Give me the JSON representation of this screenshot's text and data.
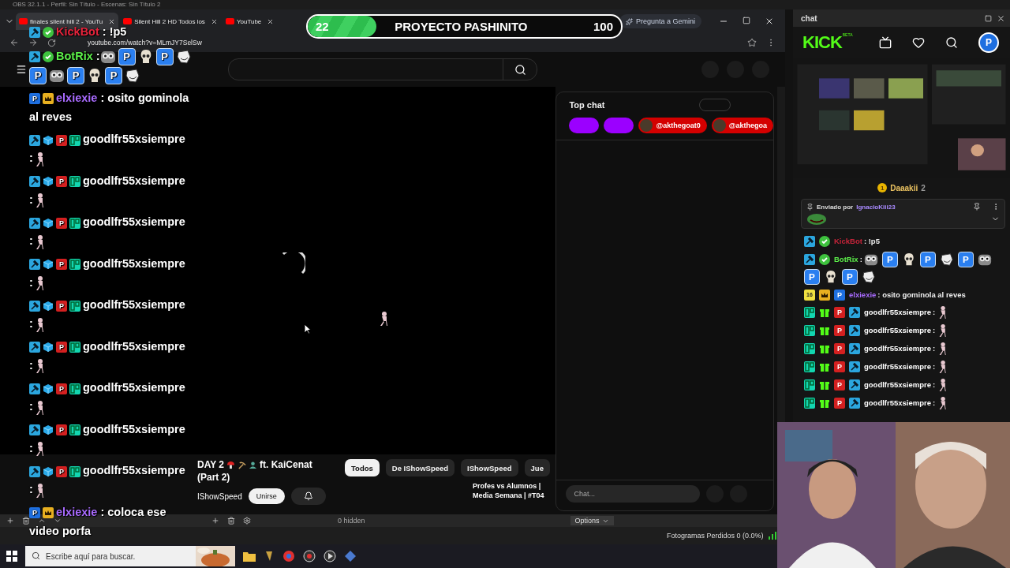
{
  "obs_title": "OBS 32.1.1 - Perfil: Sin Título - Escenas: Sin Título 2",
  "browser": {
    "tabs": [
      {
        "label": "finales silent hill 2 - YouTu",
        "selected": true
      },
      {
        "label": "Silent Hill 2 HD Todos los",
        "selected": false
      },
      {
        "label": "YouTube",
        "selected": false
      }
    ],
    "gemini": "Pregunta a Gemini",
    "url": "youtube.com/watch?v=MLmJY7SelSw"
  },
  "video": {
    "title_parts": [
      "DAY 2",
      "ft. KaiCenat"
    ],
    "title_line_2": "(Part 2)",
    "channel": "IShowSpeed",
    "join_button": "Unirse",
    "chips": [
      {
        "label": "Todos",
        "selected": true
      },
      {
        "label": "De IShowSpeed",
        "selected": false
      },
      {
        "label": "IShowSpeed",
        "selected": false
      },
      {
        "label": "Jue",
        "selected": false
      }
    ],
    "recommendation": "Profes vs Alumnos | Media Semana | #T04"
  },
  "top_chat": {
    "title": "Top chat",
    "chips": [
      {
        "kind": "blank"
      },
      {
        "kind": "blank"
      },
      {
        "kind": "user",
        "label": "@akthegoat0"
      },
      {
        "kind": "user",
        "label": "@akthegoa"
      }
    ],
    "input": {
      "placeholder": "Chat..."
    }
  },
  "goal": {
    "current": "22",
    "title": "PROYECTO PASHINITO",
    "target": "100",
    "level": 0.22
  },
  "overlay_chat": [
    {
      "kind": "inline",
      "name": "KickBot",
      "color": "#e8243c",
      "badges": [
        {
          "kind": "mod"
        },
        {
          "kind": "verified"
        }
      ],
      "text": " : !p5"
    },
    {
      "kind": "inline",
      "name": "BotRix",
      "color": "#5cf04a",
      "badges": [
        {
          "kind": "mod"
        },
        {
          "kind": "verified"
        }
      ],
      "text": " :",
      "emotes": [
        {
          "kind": "owl"
        },
        {
          "kind": "p",
          "label": "P"
        },
        {
          "kind": "skull"
        },
        {
          "kind": "p",
          "label": "P"
        },
        {
          "kind": "troll"
        },
        {
          "kind": "p",
          "label": "P"
        },
        {
          "kind": "owl"
        },
        {
          "kind": "p",
          "label": "P"
        },
        {
          "kind": "skull"
        },
        {
          "kind": "p",
          "label": "P"
        },
        {
          "kind": "troll"
        }
      ]
    },
    {
      "kind": "inline",
      "name": "elxiexie",
      "color": "#a96bff",
      "badges": [
        {
          "kind": "p",
          "label": "P"
        },
        {
          "kind": "crown"
        }
      ],
      "text": " : osito gominola",
      "text_line_2": "al reves"
    },
    {
      "kind": "block",
      "name": "goodlfr55xsiempre",
      "color": "#ffffff",
      "badges": [
        {
          "kind": "mod"
        },
        {
          "kind": "cube"
        },
        {
          "kind": "p-red",
          "label": "P"
        },
        {
          "kind": "gg"
        }
      ],
      "text": ":",
      "emotes": [
        {
          "kind": "dancer"
        }
      ]
    },
    {
      "kind": "block",
      "name": "goodlfr55xsiempre",
      "color": "#ffffff",
      "badges": [
        {
          "kind": "mod"
        },
        {
          "kind": "cube"
        },
        {
          "kind": "p-red",
          "label": "P"
        },
        {
          "kind": "gg"
        }
      ],
      "text": ":",
      "emotes": [
        {
          "kind": "dancer"
        }
      ]
    },
    {
      "kind": "block",
      "name": "goodlfr55xsiempre",
      "color": "#ffffff",
      "badges": [
        {
          "kind": "mod"
        },
        {
          "kind": "cube"
        },
        {
          "kind": "p-red",
          "label": "P"
        },
        {
          "kind": "gg"
        }
      ],
      "text": ":",
      "emotes": [
        {
          "kind": "dancer"
        }
      ]
    },
    {
      "kind": "block",
      "name": "goodlfr55xsiempre",
      "color": "#ffffff",
      "badges": [
        {
          "kind": "mod"
        },
        {
          "kind": "cube"
        },
        {
          "kind": "p-red",
          "label": "P"
        },
        {
          "kind": "gg"
        }
      ],
      "text": ":",
      "emotes": [
        {
          "kind": "dancer"
        }
      ]
    },
    {
      "kind": "block",
      "name": "goodlfr55xsiempre",
      "color": "#ffffff",
      "badges": [
        {
          "kind": "mod"
        },
        {
          "kind": "cube"
        },
        {
          "kind": "p-red",
          "label": "P"
        },
        {
          "kind": "gg"
        }
      ],
      "text": ":",
      "emotes": [
        {
          "kind": "dancer"
        }
      ]
    },
    {
      "kind": "block",
      "name": "goodlfr55xsiempre",
      "color": "#ffffff",
      "badges": [
        {
          "kind": "mod"
        },
        {
          "kind": "cube"
        },
        {
          "kind": "p-red",
          "label": "P"
        },
        {
          "kind": "gg"
        }
      ],
      "text": ":",
      "emotes": [
        {
          "kind": "dancer"
        }
      ]
    },
    {
      "kind": "block",
      "name": "goodlfr55xsiempre",
      "color": "#ffffff",
      "badges": [
        {
          "kind": "mod"
        },
        {
          "kind": "cube"
        },
        {
          "kind": "p-red",
          "label": "P"
        },
        {
          "kind": "gg"
        }
      ],
      "text": ":",
      "emotes": [
        {
          "kind": "dancer"
        }
      ]
    },
    {
      "kind": "block",
      "name": "goodlfr55xsiempre",
      "color": "#ffffff",
      "badges": [
        {
          "kind": "mod"
        },
        {
          "kind": "cube"
        },
        {
          "kind": "p-red",
          "label": "P"
        },
        {
          "kind": "gg"
        }
      ],
      "text": ":",
      "emotes": [
        {
          "kind": "dancer"
        }
      ]
    },
    {
      "kind": "block",
      "name": "goodlfr55xsiempre",
      "color": "#ffffff",
      "badges": [
        {
          "kind": "mod"
        },
        {
          "kind": "cube"
        },
        {
          "kind": "p-red",
          "label": "P"
        },
        {
          "kind": "gg"
        }
      ],
      "text": ":",
      "emotes": [
        {
          "kind": "dancer"
        }
      ]
    },
    {
      "kind": "inline",
      "name": "elxiexie",
      "color": "#a96bff",
      "badges": [
        {
          "kind": "p",
          "label": "P"
        },
        {
          "kind": "crown"
        }
      ],
      "text": " : coloca ese",
      "text_line_2": "video porfa"
    }
  ],
  "dock": {
    "title": "chat",
    "logo": "KICK",
    "logo_tag": "BETA",
    "avatar": "P",
    "leader": {
      "rank": "1",
      "name": "Daaakii",
      "count": "2"
    },
    "pinned": {
      "label": "Enviado por",
      "user": "IgnacioKiii23"
    },
    "messages": [
      {
        "name": "KickBot",
        "color": "#c8243a",
        "badges": [
          {
            "kind": "mod"
          },
          {
            "kind": "verified"
          }
        ],
        "text": ": !p5"
      },
      {
        "name": "BotRix",
        "color": "#5cf04a",
        "badges": [
          {
            "kind": "mod"
          },
          {
            "kind": "verified"
          }
        ],
        "text": ":",
        "emotes": [
          {
            "kind": "owl"
          },
          {
            "kind": "p",
            "label": "P"
          },
          {
            "kind": "skull"
          },
          {
            "kind": "p",
            "label": "P"
          },
          {
            "kind": "troll"
          },
          {
            "kind": "p",
            "label": "P"
          },
          {
            "kind": "owl"
          },
          {
            "kind": "p",
            "label": "P"
          },
          {
            "kind": "skull"
          },
          {
            "kind": "p",
            "label": "P"
          },
          {
            "kind": "troll"
          }
        ]
      },
      {
        "name": "elxiexie",
        "color": "#a96bff",
        "badges": [
          {
            "kind": "sub",
            "label": "16"
          },
          {
            "kind": "crown"
          },
          {
            "kind": "p",
            "label": "P"
          }
        ],
        "text": ": osito gominola al reves"
      },
      {
        "name": "goodlfr55xsiempre",
        "color": "#ffffff",
        "badges": [
          {
            "kind": "gg"
          },
          {
            "kind": "gift"
          },
          {
            "kind": "p-red",
            "label": "P"
          },
          {
            "kind": "mod"
          }
        ],
        "text": ":",
        "emotes": [
          {
            "kind": "dancer"
          }
        ]
      },
      {
        "name": "goodlfr55xsiempre",
        "color": "#ffffff",
        "badges": [
          {
            "kind": "gg"
          },
          {
            "kind": "gift"
          },
          {
            "kind": "p-red",
            "label": "P"
          },
          {
            "kind": "mod"
          }
        ],
        "text": ":",
        "emotes": [
          {
            "kind": "dancer"
          }
        ]
      },
      {
        "name": "goodlfr55xsiempre",
        "color": "#ffffff",
        "badges": [
          {
            "kind": "gg"
          },
          {
            "kind": "gift"
          },
          {
            "kind": "p-red",
            "label": "P"
          },
          {
            "kind": "mod"
          }
        ],
        "text": ":",
        "emotes": [
          {
            "kind": "dancer"
          }
        ]
      },
      {
        "name": "goodlfr55xsiempre",
        "color": "#ffffff",
        "badges": [
          {
            "kind": "gg"
          },
          {
            "kind": "gift"
          },
          {
            "kind": "p-red",
            "label": "P"
          },
          {
            "kind": "mod"
          }
        ],
        "text": ":",
        "emotes": [
          {
            "kind": "dancer"
          }
        ]
      },
      {
        "name": "goodlfr55xsiempre",
        "color": "#ffffff",
        "badges": [
          {
            "kind": "gg"
          },
          {
            "kind": "gift"
          },
          {
            "kind": "p-red",
            "label": "P"
          },
          {
            "kind": "mod"
          }
        ],
        "text": ":",
        "emotes": [
          {
            "kind": "dancer"
          }
        ]
      },
      {
        "name": "goodlfr55xsiempre",
        "color": "#ffffff",
        "badges": [
          {
            "kind": "gg"
          },
          {
            "kind": "gift"
          },
          {
            "kind": "p-red",
            "label": "P"
          },
          {
            "kind": "mod"
          }
        ],
        "text": ":",
        "emotes": [
          {
            "kind": "dancer"
          }
        ]
      }
    ]
  },
  "obs_bar": {
    "hidden": "0 hidden",
    "options": "Options",
    "status": "Fotogramas Perdidos 0 (0.0%)"
  },
  "taskbar": {
    "search": {
      "placeholder": "Escribe aquí para buscar."
    }
  }
}
